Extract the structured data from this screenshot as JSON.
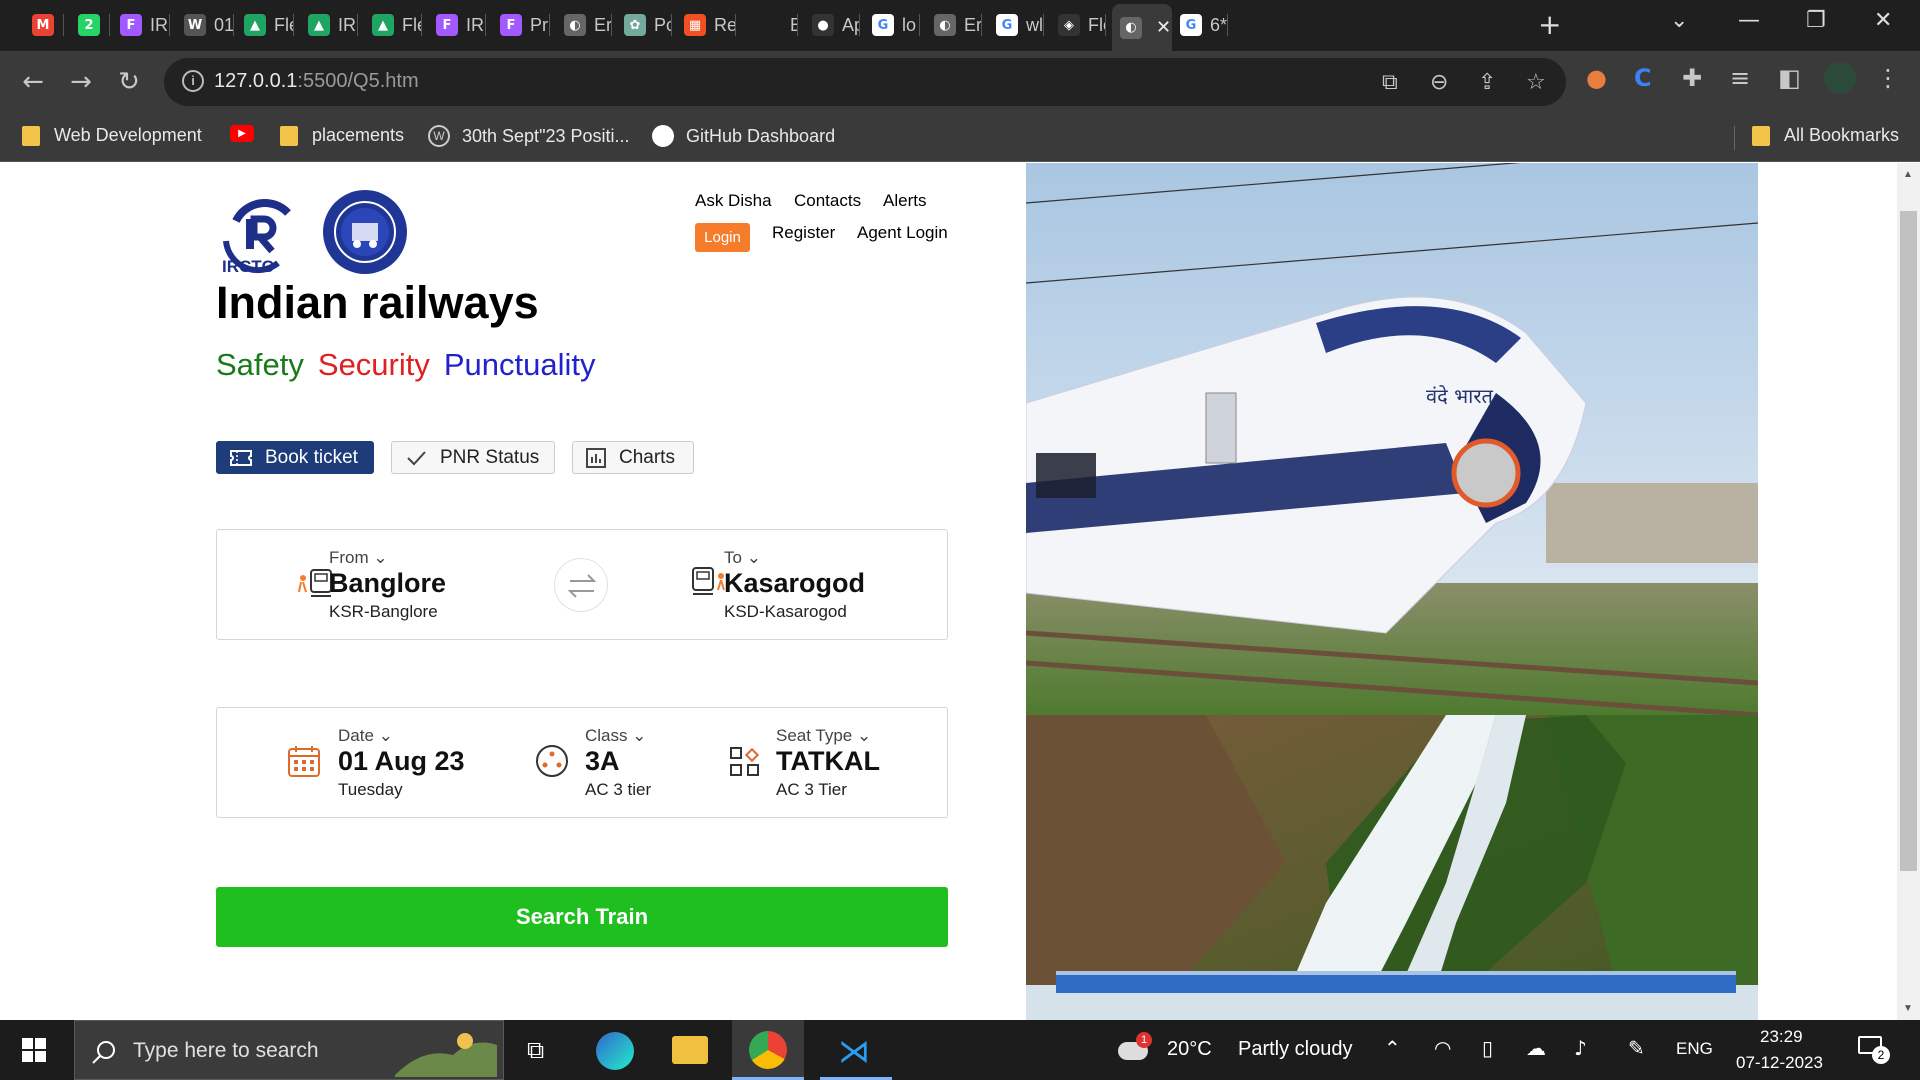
{
  "browser": {
    "tabs": [
      {
        "label": "",
        "icon": "gmail-icon",
        "color": "#ea4335",
        "letter": "M"
      },
      {
        "label": "",
        "icon": "whatsapp-icon",
        "color": "#25d366",
        "letter": "2"
      },
      {
        "label": "IR",
        "icon": "figma-icon",
        "color": "#a259ff",
        "letter": "F"
      },
      {
        "label": "01",
        "icon": "wordpress-icon",
        "color": "#555555",
        "letter": "W"
      },
      {
        "label": "Fle",
        "icon": "drive-icon",
        "color": "#1fa463",
        "letter": "▲"
      },
      {
        "label": "IR",
        "icon": "drive-icon",
        "color": "#1fa463",
        "letter": "▲"
      },
      {
        "label": "Fle",
        "icon": "drive-icon",
        "color": "#1fa463",
        "letter": "▲"
      },
      {
        "label": "IR",
        "icon": "figma-icon",
        "color": "#a259ff",
        "letter": "F"
      },
      {
        "label": "Pr",
        "icon": "figma-icon",
        "color": "#a259ff",
        "letter": "F"
      },
      {
        "label": "Er",
        "icon": "globe-icon",
        "color": "#666666",
        "letter": "◐"
      },
      {
        "label": "Pc",
        "icon": "chatgpt-icon",
        "color": "#74aa9c",
        "letter": "✿"
      },
      {
        "label": "Re",
        "icon": "microsoft-icon",
        "color": "#f25022",
        "letter": "▦"
      },
      {
        "label": "Be",
        "icon": "blank-icon",
        "color": "#1f1f1f",
        "letter": ""
      },
      {
        "label": "Ap",
        "icon": "github-icon",
        "color": "#333333",
        "letter": "●"
      },
      {
        "label": "lo",
        "icon": "google-icon",
        "color": "#ffffff",
        "letter": "G"
      },
      {
        "label": "Er",
        "icon": "globe-icon",
        "color": "#666666",
        "letter": "◐"
      },
      {
        "label": "wl",
        "icon": "google-icon",
        "color": "#ffffff",
        "letter": "G"
      },
      {
        "label": "Fle",
        "icon": "codepen-icon",
        "color": "#333333",
        "letter": "◈"
      },
      {
        "label": "",
        "icon": "globe-icon",
        "color": "#666666",
        "letter": "◐",
        "active": true
      },
      {
        "label": "6*",
        "icon": "google-icon",
        "color": "#ffffff",
        "letter": "G"
      }
    ],
    "new_tab_symbol": "+",
    "address": {
      "host": "127.0.0.1",
      "rest": ":5500/Q5.htm"
    },
    "bookmarks": [
      {
        "label": "Web Development",
        "icon": "folder-icon"
      },
      {
        "label": "",
        "icon": "youtube-icon"
      },
      {
        "label": "placements",
        "icon": "folder-icon"
      },
      {
        "label": "30th Sept\"23 Positi...",
        "icon": "wordpress-icon"
      },
      {
        "label": "GitHub Dashboard",
        "icon": "github-icon"
      }
    ],
    "all_bookmarks": "All Bookmarks"
  },
  "site": {
    "logo_text": "IRCTC",
    "brand": "Indian railways",
    "tagline": [
      {
        "text": "Safety",
        "color": "#1a7a1a"
      },
      {
        "text": "Security",
        "color": "#e02020"
      },
      {
        "text": "Punctuality",
        "color": "#2222cc"
      }
    ],
    "nav_top": [
      "Ask Disha",
      "Contacts",
      "Alerts"
    ],
    "nav_bottom": {
      "login": "Login",
      "register": "Register",
      "agent": "Agent Login"
    },
    "tabs": {
      "book": "Book ticket",
      "pnr": "PNR Status",
      "charts": "Charts"
    },
    "from": {
      "label": "From",
      "city": "Banglore",
      "code": "KSR-Banglore"
    },
    "to": {
      "label": "To",
      "city": "Kasarogod",
      "code": "KSD-Kasarogod"
    },
    "date": {
      "label": "Date",
      "value": "01 Aug 23",
      "day": "Tuesday"
    },
    "class": {
      "label": "Class",
      "value": "3A",
      "desc": "AC 3 tier"
    },
    "seat": {
      "label": "Seat Type",
      "value": "TATKAL",
      "desc": "AC 3 Tier"
    },
    "search_button": "Search Train",
    "train_livery": "वंदे भारत"
  },
  "taskbar": {
    "search_placeholder": "Type here to search",
    "weather_temp": "20°C",
    "weather_desc": "Partly cloudy",
    "weather_badge": "1",
    "language": "ENG",
    "time": "23:29",
    "date": "07-12-2023",
    "notifications": "2"
  }
}
